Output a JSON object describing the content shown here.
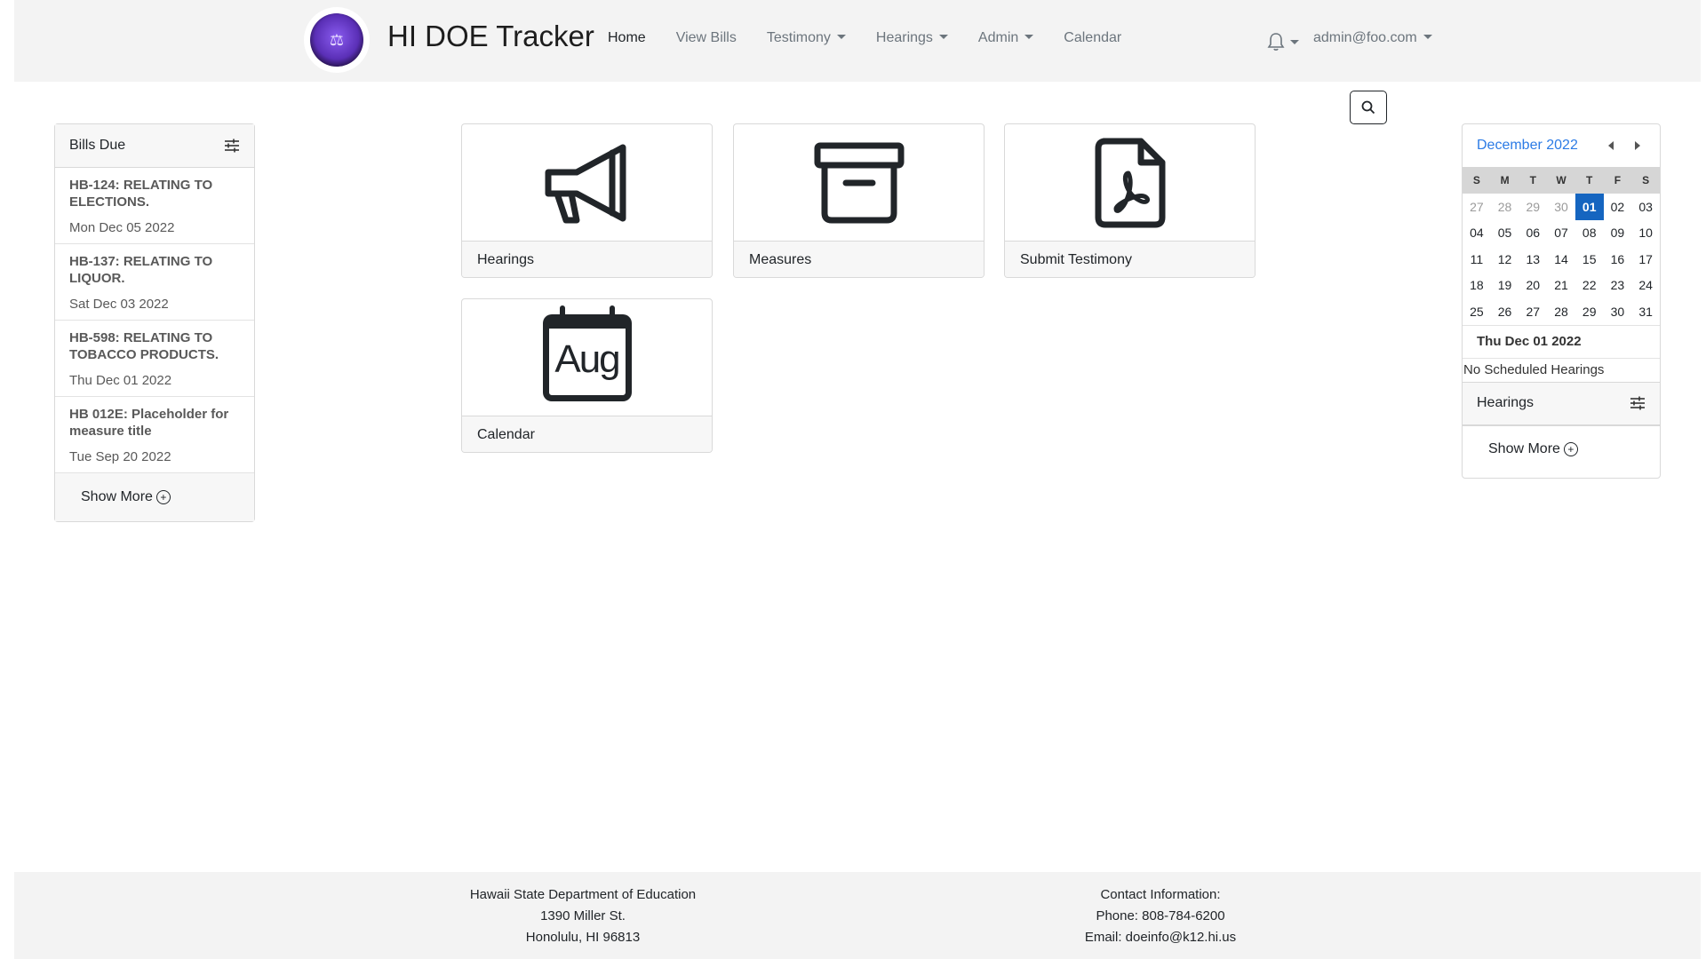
{
  "brand": {
    "title": "HI DOE Tracker",
    "logo_text": "⚖"
  },
  "nav": {
    "items": [
      {
        "label": "Home",
        "active": true,
        "dropdown": false
      },
      {
        "label": "View Bills",
        "active": false,
        "dropdown": false
      },
      {
        "label": "Testimony",
        "active": false,
        "dropdown": true
      },
      {
        "label": "Hearings",
        "active": false,
        "dropdown": true
      },
      {
        "label": "Admin",
        "active": false,
        "dropdown": true
      },
      {
        "label": "Calendar",
        "active": false,
        "dropdown": false
      }
    ],
    "user": "admin@foo.com"
  },
  "bills": {
    "header": "Bills Due",
    "items": [
      {
        "title": "HB-124: RELATING TO ELECTIONS.",
        "date": "Mon Dec 05 2022"
      },
      {
        "title": "HB-137: RELATING TO LIQUOR.",
        "date": "Sat Dec 03 2022"
      },
      {
        "title": "HB-598: RELATING TO TOBACCO PRODUCTS.",
        "date": "Thu Dec 01 2022"
      },
      {
        "title": "HB 012E: Placeholder for measure title",
        "date": "Tue Sep 20 2022"
      }
    ],
    "show_more": "Show More"
  },
  "tiles": {
    "hearings": "Hearings",
    "measures": "Measures",
    "submit_testimony": "Submit Testimony",
    "calendar": "Calendar",
    "calendar_icon_text": "Aug"
  },
  "calendar": {
    "month_label": "December 2022",
    "weekdays": [
      "S",
      "M",
      "T",
      "W",
      "T",
      "F",
      "S"
    ],
    "days": [
      {
        "d": "27",
        "muted": true
      },
      {
        "d": "28",
        "muted": true
      },
      {
        "d": "29",
        "muted": true
      },
      {
        "d": "30",
        "muted": true
      },
      {
        "d": "01",
        "selected": true
      },
      {
        "d": "02"
      },
      {
        "d": "03"
      },
      {
        "d": "04"
      },
      {
        "d": "05"
      },
      {
        "d": "06"
      },
      {
        "d": "07"
      },
      {
        "d": "08"
      },
      {
        "d": "09"
      },
      {
        "d": "10"
      },
      {
        "d": "11"
      },
      {
        "d": "12"
      },
      {
        "d": "13"
      },
      {
        "d": "14"
      },
      {
        "d": "15"
      },
      {
        "d": "16"
      },
      {
        "d": "17"
      },
      {
        "d": "18"
      },
      {
        "d": "19"
      },
      {
        "d": "20"
      },
      {
        "d": "21"
      },
      {
        "d": "22"
      },
      {
        "d": "23"
      },
      {
        "d": "24"
      },
      {
        "d": "25"
      },
      {
        "d": "26"
      },
      {
        "d": "27"
      },
      {
        "d": "28"
      },
      {
        "d": "29"
      },
      {
        "d": "30"
      },
      {
        "d": "31"
      }
    ],
    "selected_date": "Thu Dec 01 2022",
    "no_hearings": "No Scheduled Hearings"
  },
  "hearings_panel": {
    "header": "Hearings",
    "show_more": "Show More"
  },
  "footer": {
    "left": [
      "Hawaii State Department of Education",
      "1390 Miller St.",
      "Honolulu, HI 96813"
    ],
    "right": [
      "Contact Information:",
      "Phone: 808-784-6200",
      "Email: doeinfo@k12.hi.us"
    ]
  },
  "colors": {
    "accent": "#2c7be5",
    "selected_day": "#1565c0",
    "navbar_bg": "#f3f3f3"
  }
}
